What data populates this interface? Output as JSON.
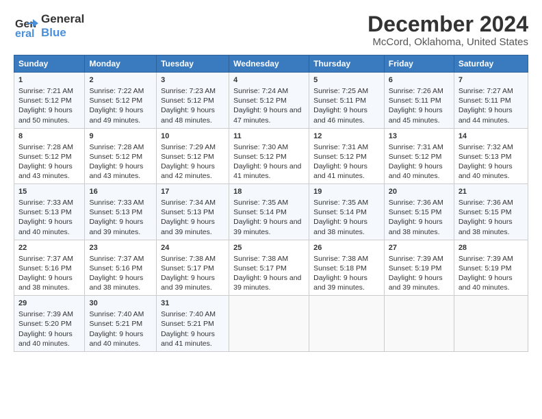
{
  "header": {
    "logo_line1": "General",
    "logo_line2": "Blue",
    "title": "December 2024",
    "subtitle": "McCord, Oklahoma, United States"
  },
  "days_of_week": [
    "Sunday",
    "Monday",
    "Tuesday",
    "Wednesday",
    "Thursday",
    "Friday",
    "Saturday"
  ],
  "weeks": [
    [
      {
        "day": "1",
        "rise": "7:21 AM",
        "set": "5:12 PM",
        "daylight": "9 hours and 50 minutes."
      },
      {
        "day": "2",
        "rise": "7:22 AM",
        "set": "5:12 PM",
        "daylight": "9 hours and 49 minutes."
      },
      {
        "day": "3",
        "rise": "7:23 AM",
        "set": "5:12 PM",
        "daylight": "9 hours and 48 minutes."
      },
      {
        "day": "4",
        "rise": "7:24 AM",
        "set": "5:12 PM",
        "daylight": "9 hours and 47 minutes."
      },
      {
        "day": "5",
        "rise": "7:25 AM",
        "set": "5:11 PM",
        "daylight": "9 hours and 46 minutes."
      },
      {
        "day": "6",
        "rise": "7:26 AM",
        "set": "5:11 PM",
        "daylight": "9 hours and 45 minutes."
      },
      {
        "day": "7",
        "rise": "7:27 AM",
        "set": "5:11 PM",
        "daylight": "9 hours and 44 minutes."
      }
    ],
    [
      {
        "day": "8",
        "rise": "7:28 AM",
        "set": "5:12 PM",
        "daylight": "9 hours and 43 minutes."
      },
      {
        "day": "9",
        "rise": "7:28 AM",
        "set": "5:12 PM",
        "daylight": "9 hours and 43 minutes."
      },
      {
        "day": "10",
        "rise": "7:29 AM",
        "set": "5:12 PM",
        "daylight": "9 hours and 42 minutes."
      },
      {
        "day": "11",
        "rise": "7:30 AM",
        "set": "5:12 PM",
        "daylight": "9 hours and 41 minutes."
      },
      {
        "day": "12",
        "rise": "7:31 AM",
        "set": "5:12 PM",
        "daylight": "9 hours and 41 minutes."
      },
      {
        "day": "13",
        "rise": "7:31 AM",
        "set": "5:12 PM",
        "daylight": "9 hours and 40 minutes."
      },
      {
        "day": "14",
        "rise": "7:32 AM",
        "set": "5:13 PM",
        "daylight": "9 hours and 40 minutes."
      }
    ],
    [
      {
        "day": "15",
        "rise": "7:33 AM",
        "set": "5:13 PM",
        "daylight": "9 hours and 40 minutes."
      },
      {
        "day": "16",
        "rise": "7:33 AM",
        "set": "5:13 PM",
        "daylight": "9 hours and 39 minutes."
      },
      {
        "day": "17",
        "rise": "7:34 AM",
        "set": "5:13 PM",
        "daylight": "9 hours and 39 minutes."
      },
      {
        "day": "18",
        "rise": "7:35 AM",
        "set": "5:14 PM",
        "daylight": "9 hours and 39 minutes."
      },
      {
        "day": "19",
        "rise": "7:35 AM",
        "set": "5:14 PM",
        "daylight": "9 hours and 38 minutes."
      },
      {
        "day": "20",
        "rise": "7:36 AM",
        "set": "5:15 PM",
        "daylight": "9 hours and 38 minutes."
      },
      {
        "day": "21",
        "rise": "7:36 AM",
        "set": "5:15 PM",
        "daylight": "9 hours and 38 minutes."
      }
    ],
    [
      {
        "day": "22",
        "rise": "7:37 AM",
        "set": "5:16 PM",
        "daylight": "9 hours and 38 minutes."
      },
      {
        "day": "23",
        "rise": "7:37 AM",
        "set": "5:16 PM",
        "daylight": "9 hours and 38 minutes."
      },
      {
        "day": "24",
        "rise": "7:38 AM",
        "set": "5:17 PM",
        "daylight": "9 hours and 39 minutes."
      },
      {
        "day": "25",
        "rise": "7:38 AM",
        "set": "5:17 PM",
        "daylight": "9 hours and 39 minutes."
      },
      {
        "day": "26",
        "rise": "7:38 AM",
        "set": "5:18 PM",
        "daylight": "9 hours and 39 minutes."
      },
      {
        "day": "27",
        "rise": "7:39 AM",
        "set": "5:19 PM",
        "daylight": "9 hours and 39 minutes."
      },
      {
        "day": "28",
        "rise": "7:39 AM",
        "set": "5:19 PM",
        "daylight": "9 hours and 40 minutes."
      }
    ],
    [
      {
        "day": "29",
        "rise": "7:39 AM",
        "set": "5:20 PM",
        "daylight": "9 hours and 40 minutes."
      },
      {
        "day": "30",
        "rise": "7:40 AM",
        "set": "5:21 PM",
        "daylight": "9 hours and 40 minutes."
      },
      {
        "day": "31",
        "rise": "7:40 AM",
        "set": "5:21 PM",
        "daylight": "9 hours and 41 minutes."
      },
      null,
      null,
      null,
      null
    ]
  ]
}
